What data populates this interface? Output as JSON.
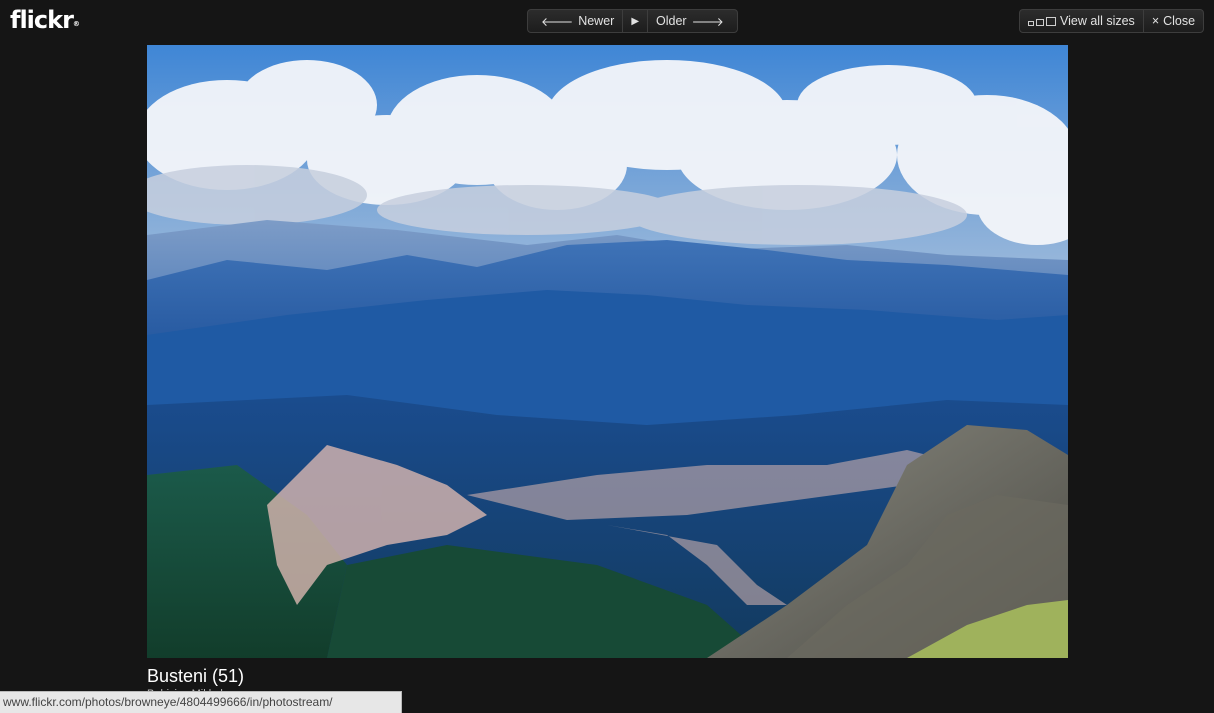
{
  "logo": {
    "text": "flickr",
    "mark": "®"
  },
  "nav": {
    "newer_label": "Newer",
    "newer_icon": "left-arrow-icon",
    "play_icon": "play-icon",
    "older_label": "Older",
    "older_icon": "right-arrow-icon"
  },
  "toolbar": {
    "view_all_sizes_label": "View all sizes",
    "view_all_sizes_icon": "sizes-icon",
    "close_label": "Close",
    "close_icon": "close-icon"
  },
  "photo": {
    "title": "Busteni (51)",
    "owner": "Babicius Mikkel",
    "description": "Aerial mountain landscape photo"
  },
  "status_bar": {
    "url": "www.flickr.com/photos/browneye/4804499666/in/photostream/"
  },
  "colors": {
    "background": "#151515",
    "button_bg": "#2c2c2c",
    "text": "#e2e2e2"
  }
}
